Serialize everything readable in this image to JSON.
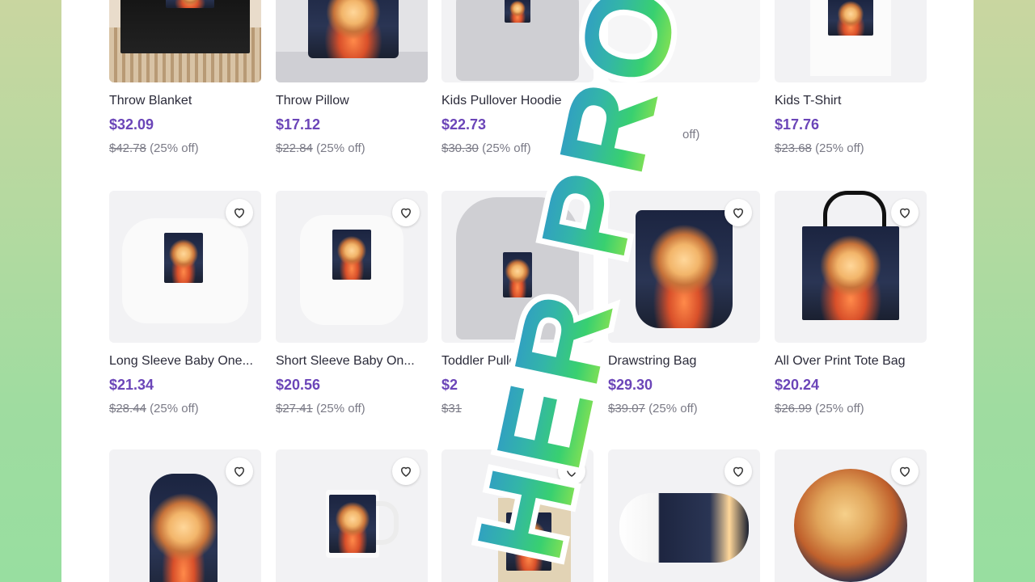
{
  "products": [
    {
      "name": "Throw Blanket",
      "price": "$32.09",
      "original": "$42.78",
      "discount": "(25% off)"
    },
    {
      "name": "Throw Pillow",
      "price": "$17.12",
      "original": "$22.84",
      "discount": "(25% off)"
    },
    {
      "name": "Kids Pullover Hoodie",
      "price": "$22.73",
      "original": "$30.30",
      "discount": "(25% off)"
    },
    {
      "name": "",
      "price": "",
      "original": "",
      "discount": "off)"
    },
    {
      "name": "Kids T-Shirt",
      "price": "$17.76",
      "original": "$23.68",
      "discount": "(25% off)"
    },
    {
      "name": "Long Sleeve Baby One...",
      "price": "$21.34",
      "original": "$28.44",
      "discount": "(25% off)"
    },
    {
      "name": "Short Sleeve Baby On...",
      "price": "$20.56",
      "original": "$27.41",
      "discount": "(25% off)"
    },
    {
      "name": "Toddler Pullover Hoodie",
      "price": "$2",
      "original": "$31",
      "discount": ""
    },
    {
      "name": "Drawstring Bag",
      "price": "$29.30",
      "original": "$39.07",
      "discount": "(25% off)"
    },
    {
      "name": "All Over Print Tote Bag",
      "price": "$20.24",
      "original": "$26.99",
      "discount": "(25% off)"
    },
    {
      "name": "",
      "price": "",
      "original": "",
      "discount": ""
    },
    {
      "name": "",
      "price": "",
      "original": "",
      "discount": ""
    },
    {
      "name": "",
      "price": "",
      "original": "",
      "discount": ""
    },
    {
      "name": "",
      "price": "",
      "original": "",
      "discount": ""
    },
    {
      "name": "",
      "price": "",
      "original": "",
      "discount": ""
    }
  ],
  "overlay": {
    "text": "HER PRODU"
  },
  "icons": {
    "favorite": "heart-outline-icon"
  },
  "colors": {
    "price": "#6b45b8",
    "background_top": "#c9d6a0",
    "background_bottom": "#98dea0"
  }
}
